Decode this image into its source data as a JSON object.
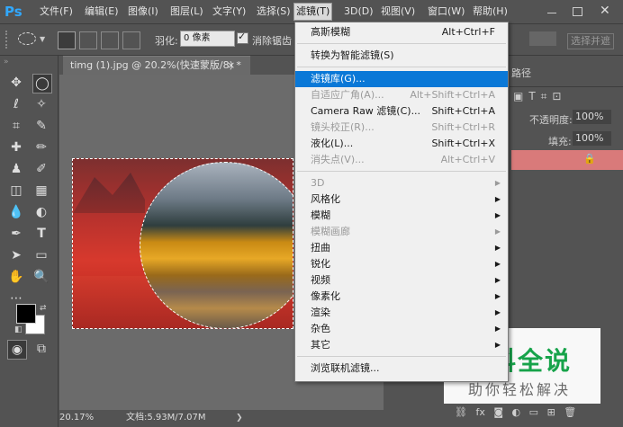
{
  "app": {
    "logo": "Ps"
  },
  "menubar": {
    "items": [
      "文件(F)",
      "编辑(E)",
      "图像(I)",
      "图层(L)",
      "文字(Y)",
      "选择(S)",
      "滤镜(T)",
      "3D(D)",
      "视图(V)",
      "窗口(W)",
      "帮助(H)"
    ],
    "active": "滤镜(T)"
  },
  "options": {
    "feather_label": "羽化:",
    "feather_value": "0 像素",
    "antialias_label": "消除锯齿",
    "select_subject": "选择并遮"
  },
  "document": {
    "tab_title": "timg (1).jpg @ 20.2%(快速蒙版/8) *",
    "close": "×",
    "zoom": "20.17%",
    "doc_size": "文档:5.93M/7.07M"
  },
  "panels": {
    "path_tab": "路径",
    "opacity_label": "不透明度:",
    "opacity_value": "100%",
    "fill_label": "填充:",
    "fill_value": "100%"
  },
  "filter_menu": {
    "items": [
      {
        "label": "高斯模糊",
        "shortcut": "Alt+Ctrl+F",
        "disabled": false
      },
      {
        "sep": true
      },
      {
        "label": "转换为智能滤镜(S)",
        "shortcut": "",
        "disabled": false
      },
      {
        "sep": true
      },
      {
        "label": "滤镜库(G)...",
        "shortcut": "",
        "disabled": false,
        "highlight": true
      },
      {
        "label": "自适应广角(A)...",
        "shortcut": "Alt+Shift+Ctrl+A",
        "disabled": true
      },
      {
        "label": "Camera Raw 滤镜(C)...",
        "shortcut": "Shift+Ctrl+A",
        "disabled": false
      },
      {
        "label": "镜头校正(R)...",
        "shortcut": "Shift+Ctrl+R",
        "disabled": true
      },
      {
        "label": "液化(L)...",
        "shortcut": "Shift+Ctrl+X",
        "disabled": false
      },
      {
        "label": "消失点(V)...",
        "shortcut": "Alt+Ctrl+V",
        "disabled": true
      },
      {
        "sep": true
      },
      {
        "label": "3D",
        "disabled": true,
        "submenu": true
      },
      {
        "label": "风格化",
        "disabled": false,
        "submenu": true
      },
      {
        "label": "模糊",
        "disabled": false,
        "submenu": true
      },
      {
        "label": "模糊画廊",
        "disabled": true,
        "submenu": true
      },
      {
        "label": "扭曲",
        "disabled": false,
        "submenu": true
      },
      {
        "label": "锐化",
        "disabled": false,
        "submenu": true
      },
      {
        "label": "视频",
        "disabled": false,
        "submenu": true
      },
      {
        "label": "像素化",
        "disabled": false,
        "submenu": true
      },
      {
        "label": "渲染",
        "disabled": false,
        "submenu": true
      },
      {
        "label": "杂色",
        "disabled": false,
        "submenu": true
      },
      {
        "label": "其它",
        "disabled": false,
        "submenu": true
      },
      {
        "sep": true
      },
      {
        "label": "浏览联机滤镜...",
        "shortcut": "",
        "disabled": false
      }
    ]
  },
  "watermark": {
    "title": "百科全说",
    "subtitle": "助你轻松解决"
  }
}
